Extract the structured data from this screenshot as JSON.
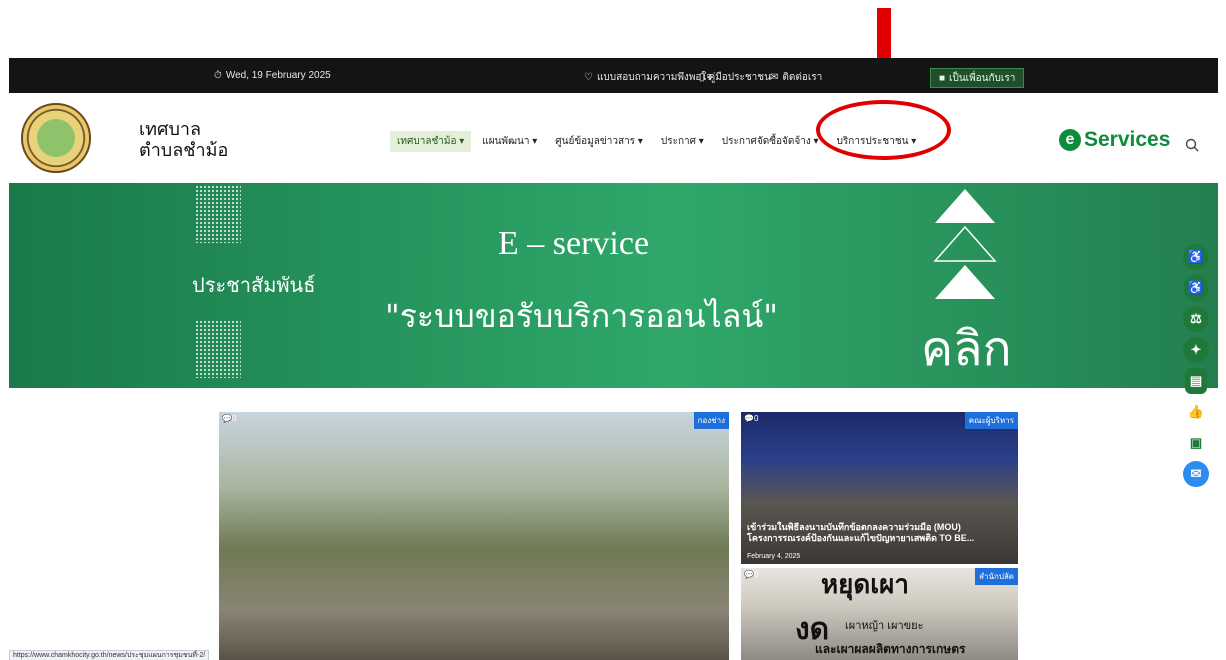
{
  "topbar": {
    "date": "Wed, 19 February 2025",
    "survey_link": "แบบสอบถามความพึงพอใจ",
    "manual_link": "คู่มือประชาชน",
    "contact_link": "ติดต่อเรา",
    "friend_button": "เป็นเพื่อนกับเรา"
  },
  "site": {
    "name_line1": "เทศบาล",
    "name_line2": "ตำบลชำม้อ"
  },
  "menu": [
    {
      "label": "เทศบาลชำม้อ"
    },
    {
      "label": "แผนพัฒนา"
    },
    {
      "label": "ศูนย์ข้อมูลข่าวสาร"
    },
    {
      "label": "ประกาศ"
    },
    {
      "label": "ประกาศจัดซื้อจัดจ้าง"
    },
    {
      "label": "บริการประชาชน"
    }
  ],
  "eservices_logo": {
    "mark": "e",
    "text": "Services"
  },
  "banner": {
    "left_text": "ประชาสัมพันธ์",
    "title": "E – service",
    "subtitle": "\"ระบบขอรับบริการออนไลน์\"",
    "click_text": "คลิก"
  },
  "news": [
    {
      "count": "0",
      "badge": "กองช่าง",
      "title": "",
      "date": ""
    },
    {
      "count": "0",
      "badge": "คณะผู้บริหาร",
      "title_line1": "เข้าร่วมในพิธีลงนามบันทึกข้อตกลงความร่วมมือ (MOU)",
      "title_line2": "โครงการรณรงค์ป้องกันและแก้ไขปัญหายาเสพติด TO BE...",
      "date": "February 4, 2025"
    },
    {
      "count": "0",
      "badge": "สำนักปลัด",
      "poster_big": "หยุดเผา",
      "poster_mid": "งด",
      "poster_text1": "เผาหญ้า เผาขยะ",
      "poster_text2": "และเผาผลผลิตทางการเกษตร"
    }
  ],
  "statusbar_url": "https://www.chamkhocity.go.th/news/ประชุมแผนการชุมชนที่-2/",
  "colors": {
    "topbar": "#141414",
    "banner": "#2a9a5e",
    "accent_green": "#0f8b3c",
    "annotation_red": "#e00000"
  }
}
